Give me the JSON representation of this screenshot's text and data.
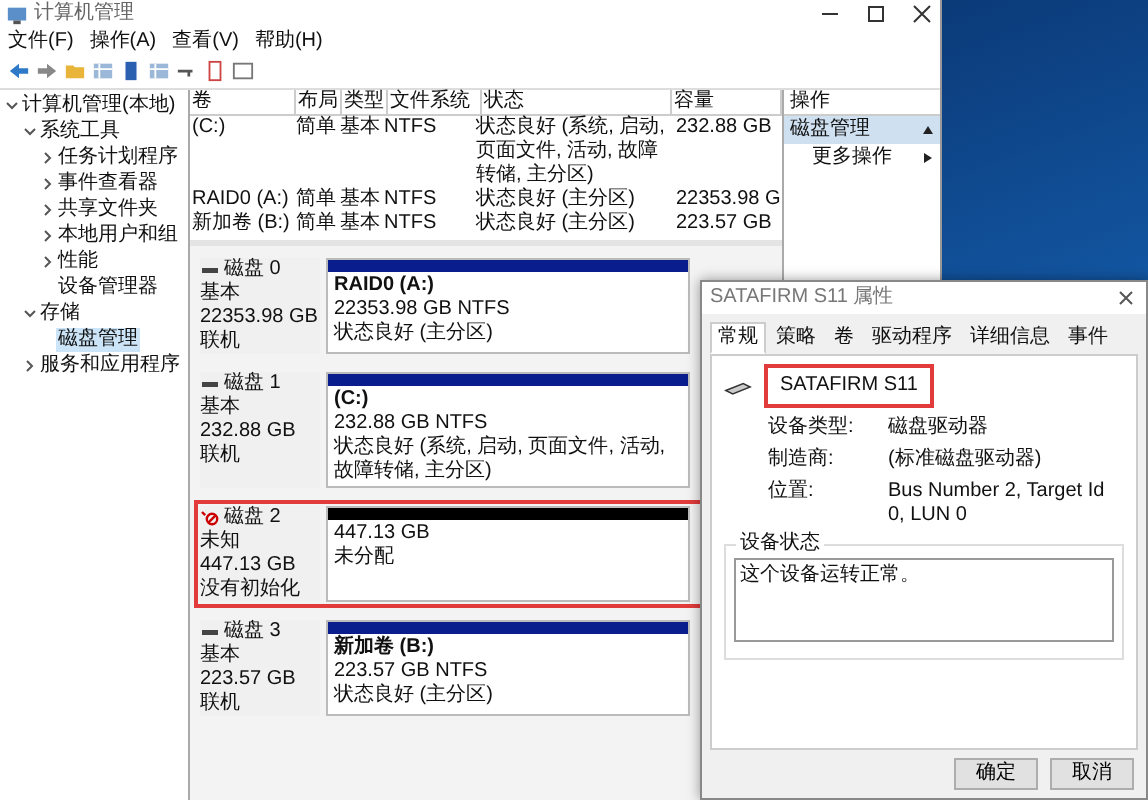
{
  "window": {
    "title": "计算机管理"
  },
  "menu": [
    "文件(F)",
    "操作(A)",
    "查看(V)",
    "帮助(H)"
  ],
  "tree": [
    {
      "label": "计算机管理(本地)",
      "expanded": true,
      "selected": false,
      "children": [
        {
          "label": "系统工具",
          "expanded": true,
          "selected": false,
          "children": [
            {
              "label": "任务计划程序",
              "expanded": false,
              "selected": false
            },
            {
              "label": "事件查看器",
              "expanded": false,
              "selected": false
            },
            {
              "label": "共享文件夹",
              "expanded": false,
              "selected": false
            },
            {
              "label": "本地用户和组",
              "expanded": false,
              "selected": false
            },
            {
              "label": "性能",
              "expanded": false,
              "selected": false
            },
            {
              "label": "设备管理器",
              "selected": false
            }
          ]
        },
        {
          "label": "存储",
          "expanded": true,
          "selected": false,
          "children": [
            {
              "label": "磁盘管理",
              "selected": true
            }
          ]
        },
        {
          "label": "服务和应用程序",
          "expanded": false,
          "selected": false
        }
      ]
    }
  ],
  "volumes": {
    "columns": [
      "卷",
      "布局",
      "类型",
      "文件系统",
      "状态",
      "容量"
    ],
    "rows": [
      [
        "(C:)",
        "简单",
        "基本",
        "NTFS",
        "状态良好 (系统, 启动, 页面文件, 活动, 故障转储, 主分区)",
        "232.88 GB"
      ],
      [
        "RAID0 (A:)",
        "简单",
        "基本",
        "NTFS",
        "状态良好 (主分区)",
        "22353.98 G"
      ],
      [
        "新加卷 (B:)",
        "简单",
        "基本",
        "NTFS",
        "状态良好 (主分区)",
        "223.57 GB"
      ]
    ]
  },
  "actions": {
    "title": "操作",
    "section": "磁盘管理",
    "items": [
      "更多操作"
    ]
  },
  "disks": [
    {
      "name": "磁盘 0",
      "type": "基本",
      "size": "22353.98 GB",
      "status": "联机",
      "unknown": false,
      "highlighted": false,
      "partition": {
        "kind": "primary",
        "name": "RAID0  (A:)",
        "size": "22353.98 GB NTFS",
        "status": "状态良好 (主分区)"
      }
    },
    {
      "name": "磁盘 1",
      "type": "基本",
      "size": "232.88 GB",
      "status": "联机",
      "unknown": false,
      "highlighted": false,
      "partition": {
        "kind": "primary",
        "name": "(C:)",
        "size": "232.88 GB NTFS",
        "status": "状态良好 (系统, 启动, 页面文件, 活动, 故障转储, 主分区)"
      }
    },
    {
      "name": "磁盘 2",
      "type": "未知",
      "size": "447.13 GB",
      "status": "没有初始化",
      "unknown": true,
      "highlighted": true,
      "partition": {
        "kind": "unallocated",
        "size": "447.13 GB",
        "status": "未分配"
      }
    },
    {
      "name": "磁盘 3",
      "type": "基本",
      "size": "223.57 GB",
      "status": "联机",
      "unknown": false,
      "highlighted": false,
      "partition": {
        "kind": "primary",
        "name": "新加卷  (B:)",
        "size": "223.57 GB NTFS",
        "status": "状态良好 (主分区)"
      }
    }
  ],
  "dialog": {
    "title": "SATAFIRM   S11 属性",
    "tabs": [
      {
        "label": "常规",
        "selected": true
      },
      {
        "label": "策略",
        "selected": false
      },
      {
        "label": "卷",
        "selected": false
      },
      {
        "label": "驱动程序",
        "selected": false
      },
      {
        "label": "详细信息",
        "selected": false
      },
      {
        "label": "事件",
        "selected": false
      }
    ],
    "device_name": "SATAFIRM   S11",
    "highlighted": true,
    "fields": [
      {
        "label": "设备类型:",
        "value": "磁盘驱动器"
      },
      {
        "label": "制造商:",
        "value": "(标准磁盘驱动器)"
      },
      {
        "label": "位置:",
        "value": "Bus Number 2, Target Id 0, LUN 0"
      }
    ],
    "status_group": "设备状态",
    "status_text": "这个设备运转正常。",
    "buttons": [
      "确定",
      "取消"
    ]
  }
}
